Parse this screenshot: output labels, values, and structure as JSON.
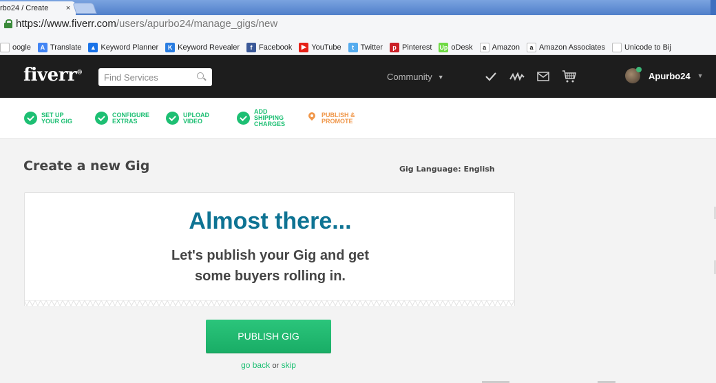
{
  "browser": {
    "tab_title": "rbo24 / Create",
    "tab_close": "×",
    "url_host": "https://www.fiverr.com",
    "url_path": "/users/apurbo24/manage_gigs/new"
  },
  "bookmarks": [
    {
      "label": "oogle",
      "icon": "google-icon",
      "color": "#ffffff",
      "glyph": ""
    },
    {
      "label": "Translate",
      "icon": "translate-icon",
      "color": "#4285f4",
      "glyph": "A"
    },
    {
      "label": "Keyword Planner",
      "icon": "adwords-icon",
      "color": "#1a73e8",
      "glyph": "▲"
    },
    {
      "label": "Keyword Revealer",
      "icon": "keyword-revealer-icon",
      "color": "#2a7de1",
      "glyph": "K"
    },
    {
      "label": "Facebook",
      "icon": "facebook-icon",
      "color": "#3b5998",
      "glyph": "f"
    },
    {
      "label": "YouTube",
      "icon": "youtube-icon",
      "color": "#e62117",
      "glyph": "▶"
    },
    {
      "label": "Twitter",
      "icon": "twitter-icon",
      "color": "#55acee",
      "glyph": "t"
    },
    {
      "label": "Pinterest",
      "icon": "pinterest-icon",
      "color": "#cb2027",
      "glyph": "p"
    },
    {
      "label": "oDesk",
      "icon": "odesk-icon",
      "color": "#6fda44",
      "glyph": "Up"
    },
    {
      "label": "Amazon",
      "icon": "amazon-icon",
      "color": "#ffffff",
      "glyph": "a"
    },
    {
      "label": "Amazon Associates",
      "icon": "amazon-associates-icon",
      "color": "#ffffff",
      "glyph": "a"
    },
    {
      "label": "Unicode to Bij",
      "icon": "page-icon",
      "color": "#ffffff",
      "glyph": ""
    }
  ],
  "header": {
    "logo": "fiverr",
    "logo_mark": "®",
    "search_placeholder": "Find Services",
    "community": "Community",
    "username": "Apurbo24"
  },
  "steps": [
    {
      "line1": "SET UP",
      "line2": "YOUR GIG",
      "state": "done"
    },
    {
      "line1": "CONFIGURE",
      "line2": "EXTRAS",
      "state": "done"
    },
    {
      "line1": "UPLOAD",
      "line2": "VIDEO",
      "state": "done"
    },
    {
      "line1": "ADD SHIPPING",
      "line2": "CHARGES",
      "state": "done"
    },
    {
      "line1": "PUBLISH &",
      "line2": "PROMOTE",
      "state": "current"
    }
  ],
  "main": {
    "title": "Create a new Gig",
    "language": "Gig Language: English",
    "headline": "Almost there...",
    "subtitle_line1": "Let's publish your Gig and get",
    "subtitle_line2": "some buyers rolling in.",
    "publish_button": "PUBLISH GIG",
    "go_back": "go back",
    "or": "or",
    "skip": "skip"
  },
  "colors": {
    "brand_green": "#1dbf73",
    "headline_blue": "#0e7393",
    "current_step_orange": "#f0974a",
    "header_bg": "#1d1d1d"
  }
}
